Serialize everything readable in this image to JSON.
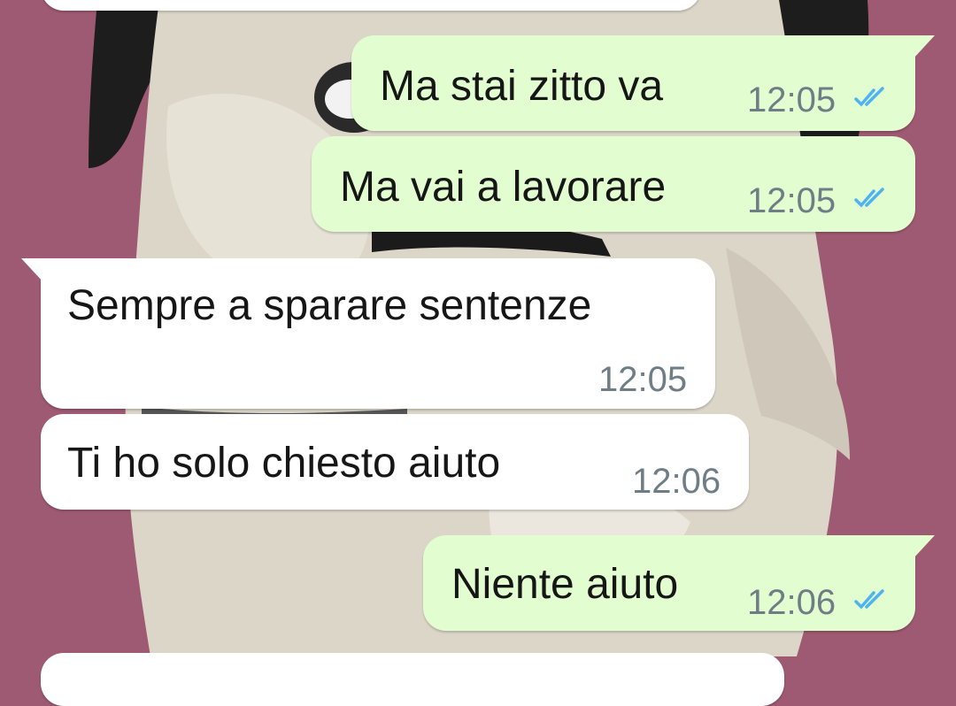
{
  "colors": {
    "wallpaper": "#9e5a72",
    "outgoing_bubble": "#e2fdd0",
    "incoming_bubble": "#ffffff",
    "read_ticks": "#4fb3f2"
  },
  "messages": [
    {
      "direction": "outgoing",
      "text": "Ma stai zitto va",
      "time": "12:05",
      "status_icon": "double-check-read-icon"
    },
    {
      "direction": "outgoing",
      "text": "Ma vai a lavorare",
      "time": "12:05",
      "status_icon": "double-check-read-icon"
    },
    {
      "direction": "incoming",
      "text": "Sempre a sparare sentenze",
      "time": "12:05"
    },
    {
      "direction": "incoming",
      "text": "Ti ho solo chiesto aiuto",
      "time": "12:06"
    },
    {
      "direction": "outgoing",
      "text": "Niente aiuto",
      "time": "12:06",
      "status_icon": "double-check-read-icon"
    }
  ]
}
